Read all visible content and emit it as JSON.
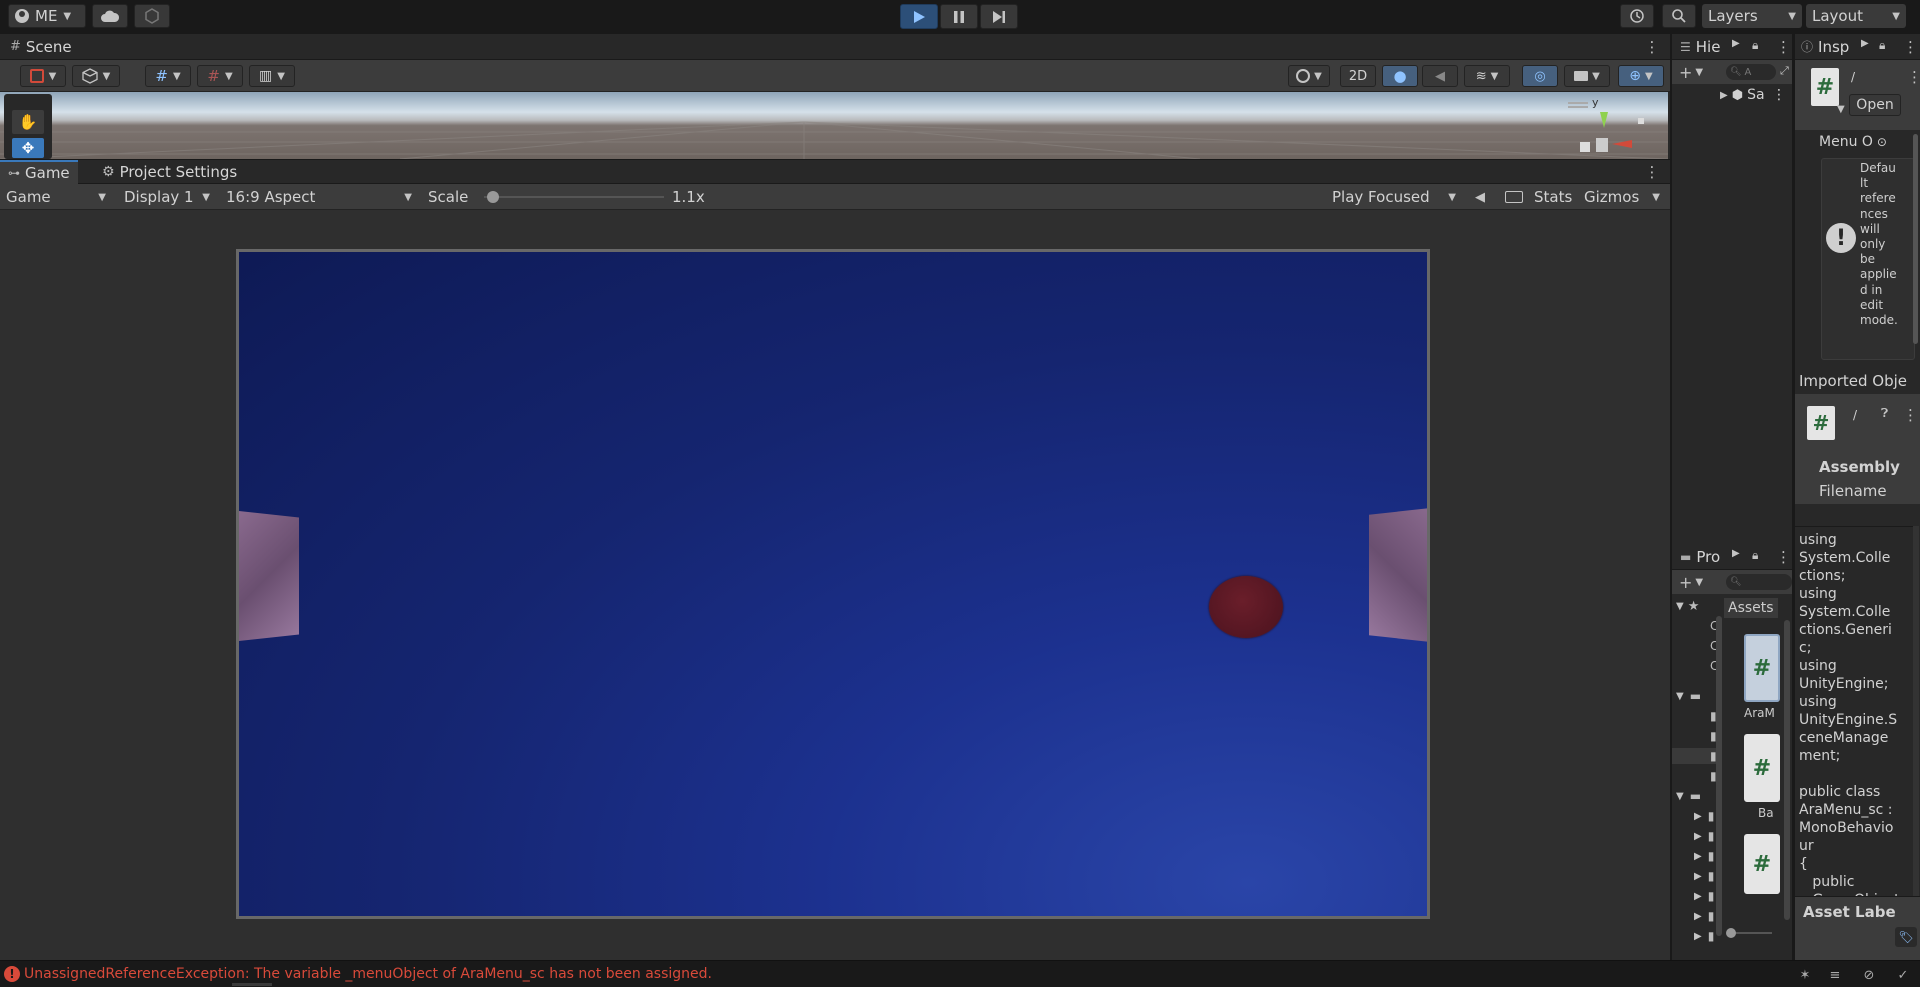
{
  "toolbar": {
    "account_label": "ME",
    "layers_label": "Layers",
    "layout_label": "Layout"
  },
  "scene": {
    "tab_label": "Scene",
    "mode_2d": "2D",
    "gizmo_axis": "y"
  },
  "game": {
    "tabs": [
      {
        "label": "Game"
      },
      {
        "label": "Project Settings"
      }
    ],
    "view_mode": "Game",
    "display": "Display 1",
    "aspect": "16:9 Aspect",
    "scale_label": "Scale",
    "scale_value": "1.1x",
    "scale_fraction": 0.02,
    "play_mode": "Play Focused",
    "stats_label": "Stats",
    "gizmos_label": "Gizmos"
  },
  "hierarchy": {
    "tab_label": "Hie",
    "search_placeholder": "A",
    "scene_item": "Sa"
  },
  "inspector": {
    "tab_label": "Insp",
    "open_button": "Open",
    "slash": "/",
    "menu_field": "Menu O",
    "warning_lines": [
      "Defau",
      "lt",
      "refere",
      "nces",
      "will",
      "only",
      "be",
      "applie",
      "d in",
      "edit",
      "mode."
    ],
    "imported_title": "Imported Obje",
    "slash2": "/",
    "assembly_label": "Assembly",
    "filename_label": "Filename",
    "code_lines": [
      "using",
      "System.Colle",
      "ctions;",
      "using",
      "System.Colle",
      "ctions.Generi",
      "c;",
      "using",
      "UnityEngine;",
      "using",
      "UnityEngine.S",
      "ceneManage",
      "ment;",
      "",
      "public class",
      "AraMenu_sc :",
      "MonoBehavio",
      "ur",
      "{",
      "   public",
      "   GameObject"
    ],
    "asset_labels": "Asset Labe"
  },
  "project": {
    "tab_label": "Pro",
    "breadcrumb": "Assets",
    "assets": [
      {
        "name": "AraM"
      },
      {
        "name": "Ba"
      },
      {
        "name": ""
      }
    ],
    "fav_letters": [
      "C",
      "C",
      "C"
    ]
  },
  "status": {
    "error_message": "UnassignedReferenceException: The variable _menuObject of AraMenu_sc has not been assigned."
  },
  "colors": {
    "accent": "#3a79bb",
    "error": "#d94a3a",
    "play_active": "#2c4f78",
    "game_bg": "#162573"
  }
}
